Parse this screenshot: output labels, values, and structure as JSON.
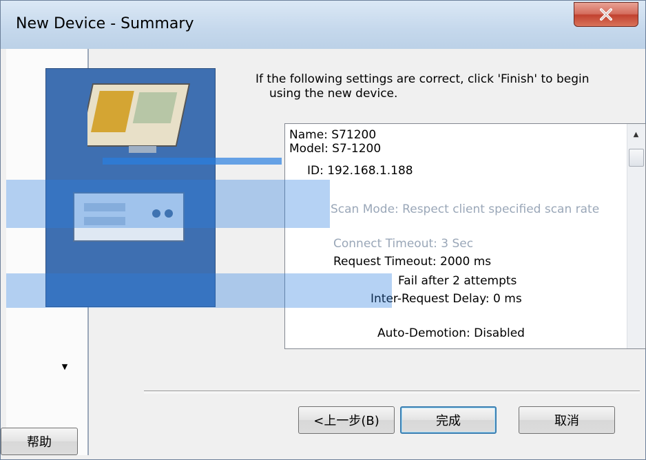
{
  "window": {
    "title": "New Device - Summary",
    "close_label": "X"
  },
  "intro": {
    "line1": "If the following settings are correct, click 'Finish' to begin",
    "line2": "using the new device."
  },
  "summary": {
    "lines": [
      "Name: S71200",
      "Model: S7-1200",
      "ID: 192.168.1.188",
      "Scan Mode: Respect client specified scan rate",
      "Connect Timeout: 3 Sec",
      "Request Timeout: 2000 ms",
      "Fail after 2 attempts",
      "Inter-Request Delay: 0 ms",
      "Auto-Demotion: Disabled"
    ]
  },
  "buttons": {
    "back": "<上一步(B)",
    "finish": "完成",
    "cancel": "取消",
    "help": "帮助"
  }
}
